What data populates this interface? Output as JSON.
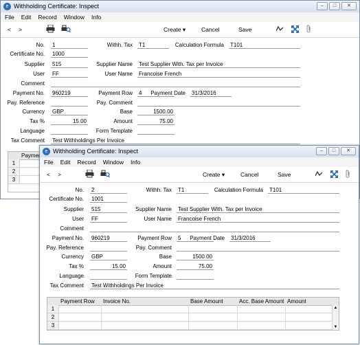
{
  "windows": [
    {
      "title": "Withholding Certificate: Inspect",
      "menu": [
        "File",
        "Edit",
        "Record",
        "Window",
        "Info"
      ],
      "toolbar": {
        "prev": "<",
        "next": ">",
        "create": "Create",
        "cancel": "Cancel",
        "save": "Save"
      },
      "form": {
        "no_label": "No.",
        "no": "1",
        "withh_tax_label": "Withh. Tax",
        "withh_tax": "T1",
        "calc_formula_label": "Calculation Formula",
        "calc_formula": "T101",
        "cert_no_label": "Certificate No.",
        "cert_no": "1000",
        "supplier_label": "Supplier",
        "supplier": "515",
        "supplier_name_label": "Supplier Name",
        "supplier_name": "Test Supplier With. Tax per Invoice",
        "user_label": "User",
        "user": "FF",
        "user_name_label": "User Name",
        "user_name": "Francoise French",
        "comment_label": "Comment",
        "comment": "",
        "payment_no_label": "Payment No.",
        "payment_no": "960219",
        "payment_row_label": "Payment Row",
        "payment_row": "4",
        "payment_date_label": "Payment Date",
        "payment_date": "31/3/2016",
        "pay_ref_label": "Pay. Reference",
        "pay_ref": "",
        "pay_comment_label": "Pay. Comment",
        "pay_comment": "",
        "currency_label": "Currency",
        "currency": "GBP",
        "base_label": "Base",
        "base": "1500.00",
        "tax_pct_label": "Tax %",
        "tax_pct": "15.00",
        "amount_label": "Amount",
        "amount": "75.00",
        "language_label": "Language",
        "language": "",
        "form_template_label": "Form Template",
        "form_template": "",
        "tax_comment_label": "Tax Comment",
        "tax_comment": "Test Withholdings Per Invoice"
      },
      "grid": {
        "headers": [
          "Payment"
        ],
        "rows": [
          "1",
          "2",
          "3"
        ]
      }
    },
    {
      "title": "Withholding Certificate: Inspect",
      "menu": [
        "File",
        "Edit",
        "Record",
        "Window",
        "Info"
      ],
      "toolbar": {
        "prev": "<",
        "next": ">",
        "create": "Create",
        "cancel": "Cancel",
        "save": "Save"
      },
      "form": {
        "no_label": "No.",
        "no": "2",
        "withh_tax_label": "Withh. Tax",
        "withh_tax": "T1",
        "calc_formula_label": "Calculation Formula",
        "calc_formula": "T101",
        "cert_no_label": "Certificate No.",
        "cert_no": "1001",
        "supplier_label": "Supplier",
        "supplier": "515",
        "supplier_name_label": "Supplier Name",
        "supplier_name": "Test Supplier With. Tax per Invoice",
        "user_label": "User",
        "user": "FF",
        "user_name_label": "User Name",
        "user_name": "Francoise French",
        "comment_label": "Comment",
        "comment": "",
        "payment_no_label": "Payment No.",
        "payment_no": "960219",
        "payment_row_label": "Payment Row",
        "payment_row": "5",
        "payment_date_label": "Payment Date",
        "payment_date": "31/3/2016",
        "pay_ref_label": "Pay. Reference",
        "pay_ref": "",
        "pay_comment_label": "Pay. Comment",
        "pay_comment": "",
        "currency_label": "Currency",
        "currency": "GBP",
        "base_label": "Base",
        "base": "1500.00",
        "tax_pct_label": "Tax %",
        "tax_pct": "15.00",
        "amount_label": "Amount",
        "amount": "75.00",
        "language_label": "Language",
        "language": "",
        "form_template_label": "Form Template",
        "form_template": "",
        "tax_comment_label": "Tax Comment",
        "tax_comment": "Test Withholdings Per Invoice"
      },
      "grid": {
        "headers": [
          "Payment Row",
          "Invoice No.",
          "Base Amount",
          "Acc. Base Amount",
          "Amount"
        ],
        "rows": [
          "1",
          "2",
          "3"
        ]
      }
    }
  ],
  "colors": {
    "accent": "#2f6db5",
    "titlebar": "#dfe8f3"
  }
}
